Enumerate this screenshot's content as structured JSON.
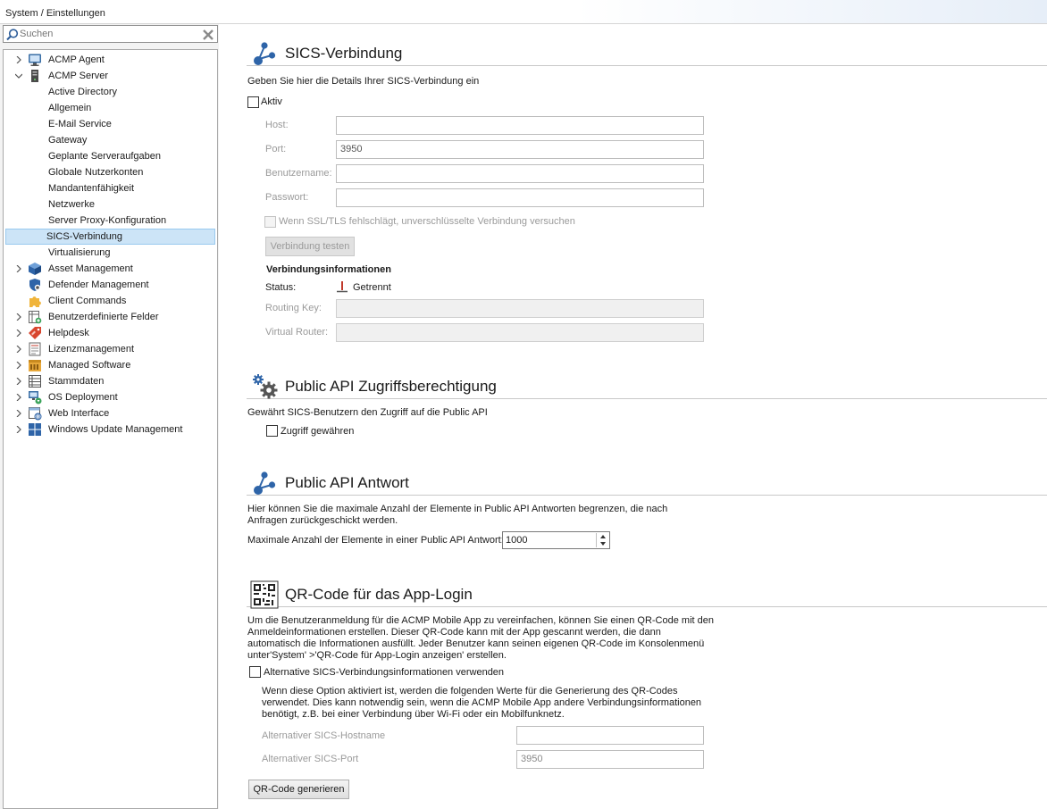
{
  "breadcrumb": "System / Einstellungen",
  "search": {
    "placeholder": "Suchen",
    "value": "Suchen"
  },
  "tree": [
    {
      "label": "ACMP Agent",
      "level": 0,
      "expander": "collapsed",
      "icon": "monitor-icon"
    },
    {
      "label": "ACMP Server",
      "level": 0,
      "expander": "expanded",
      "icon": "server-tower-icon"
    },
    {
      "label": "Active Directory",
      "level": 1
    },
    {
      "label": "Allgemein",
      "level": 1
    },
    {
      "label": "E-Mail Service",
      "level": 1
    },
    {
      "label": "Gateway",
      "level": 1
    },
    {
      "label": "Geplante Serveraufgaben",
      "level": 1
    },
    {
      "label": "Globale Nutzerkonten",
      "level": 1
    },
    {
      "label": "Mandantenfähigkeit",
      "level": 1
    },
    {
      "label": "Netzwerke",
      "level": 1
    },
    {
      "label": "Server Proxy-Konfiguration",
      "level": 1
    },
    {
      "label": "SICS-Verbindung",
      "level": 1,
      "selected": true
    },
    {
      "label": "Virtualisierung",
      "level": 1
    },
    {
      "label": "Asset Management",
      "level": 0,
      "expander": "collapsed",
      "icon": "cube-icon"
    },
    {
      "label": "Defender Management",
      "level": 0,
      "expander": "none",
      "icon": "shield-icon"
    },
    {
      "label": "Client Commands",
      "level": 0,
      "expander": "none",
      "icon": "puzzle-icon"
    },
    {
      "label": "Benutzerdefinierte Felder",
      "level": 0,
      "expander": "collapsed",
      "icon": "custom-fields-icon"
    },
    {
      "label": "Helpdesk",
      "level": 0,
      "expander": "collapsed",
      "icon": "helpdesk-tag-icon"
    },
    {
      "label": "Lizenzmanagement",
      "level": 0,
      "expander": "collapsed",
      "icon": "license-icon"
    },
    {
      "label": "Managed Software",
      "level": 0,
      "expander": "collapsed",
      "icon": "package-icon"
    },
    {
      "label": "Stammdaten",
      "level": 0,
      "expander": "collapsed",
      "icon": "master-data-icon"
    },
    {
      "label": "OS Deployment",
      "level": 0,
      "expander": "collapsed",
      "icon": "os-deployment-icon"
    },
    {
      "label": "Web Interface",
      "level": 0,
      "expander": "collapsed",
      "icon": "web-interface-icon"
    },
    {
      "label": "Windows Update Management",
      "level": 0,
      "expander": "collapsed",
      "icon": "windows-icon"
    }
  ],
  "sics": {
    "title": "SICS-Verbindung",
    "description": "Geben Sie hier die Details Ihrer SICS-Verbindung ein",
    "active_label": "Aktiv",
    "active_checked": false,
    "host_label": "Host:",
    "host_value": "",
    "port_label": "Port:",
    "port_value": "3950",
    "user_label": "Benutzername:",
    "user_value": "",
    "password_label": "Passwort:",
    "password_value": "",
    "ssl_label": "Wenn SSL/TLS fehlschlägt, unverschlüsselte Verbindung versuchen",
    "test_button": "Verbindung testen",
    "info_heading": "Verbindungsinformationen",
    "status_label": "Status:",
    "status_value": "Getrennt",
    "routing_key_label": "Routing Key:",
    "routing_key_value": "",
    "virtual_router_label": "Virtual Router:",
    "virtual_router_value": ""
  },
  "api_access": {
    "title": "Public API Zugriffsberechtigung",
    "description": "Gewährt SICS-Benutzern den Zugriff auf die Public API",
    "grant_label": "Zugriff gewähren",
    "grant_checked": false
  },
  "api_response": {
    "title": "Public API Antwort",
    "description_line1": "Hier können Sie die maximale Anzahl der Elemente in Public API Antworten begrenzen, die nach",
    "description_line2": "Anfragen zurückgeschickt werden.",
    "max_label": "Maximale Anzahl der Elemente in einer Public API Antwort:",
    "max_value": "1000"
  },
  "qr": {
    "title": "QR-Code für das App-Login",
    "description_line1": "Um die Benutzeranmeldung für die ACMP Mobile App zu vereinfachen, können Sie einen QR-Code mit den",
    "description_line2": "Anmeldeinformationen erstellen. Dieser QR-Code kann mit der App gescannt werden, die dann",
    "description_line3": "automatisch die Informationen ausfüllt. Jeder Benutzer kann seinen eigenen QR-Code im Konsolenmenü",
    "description_line4": "unter'System' >'QR-Code für App-Login anzeigen' erstellen.",
    "alt_label": "Alternative SICS-Verbindungsinformationen verwenden",
    "alt_checked": false,
    "alt_note_line1": "Wenn diese Option aktiviert ist, werden die folgenden Werte für die Generierung des QR-Codes",
    "alt_note_line2": "verwendet. Dies kann notwendig sein, wenn die ACMP Mobile App andere Verbindungsinformationen",
    "alt_note_line3": "benötigt, z.B. bei einer Verbindung über Wi-Fi oder ein Mobilfunknetz.",
    "alt_host_label": "Alternativer SICS-Hostname",
    "alt_host_value": "",
    "alt_port_label": "Alternativer SICS-Port",
    "alt_port_value": "3950",
    "generate_button": "QR-Code generieren"
  }
}
